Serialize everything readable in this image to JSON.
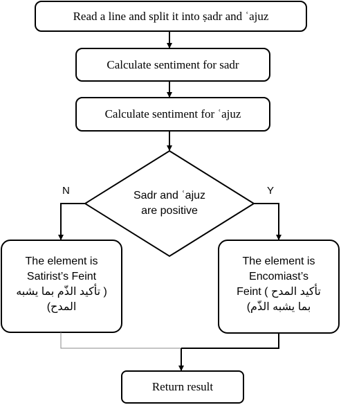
{
  "nodes": {
    "start": "Read a line and split it into ṣadr and ʿajuz",
    "calc_sadr": "Calculate sentiment for sadr",
    "calc_ajuz": "Calculate sentiment for ʿajuz",
    "decision": {
      "line1": "Sadr and ʿajuz",
      "line2": "are positive"
    },
    "left": {
      "line1": "The element is",
      "line2": "Satirist’s Feint",
      "line3": "تأكيد الذّم بما يشبه )",
      "line4": "(المدح"
    },
    "right": {
      "line1": "The  element is",
      "line2": "Encomiast’s",
      "line3": "Feint ( تأكيد المدح",
      "line4": "(بما يشبه الذّم"
    },
    "end": "Return result"
  },
  "edges": {
    "no_label": "N",
    "yes_label": "Y"
  }
}
